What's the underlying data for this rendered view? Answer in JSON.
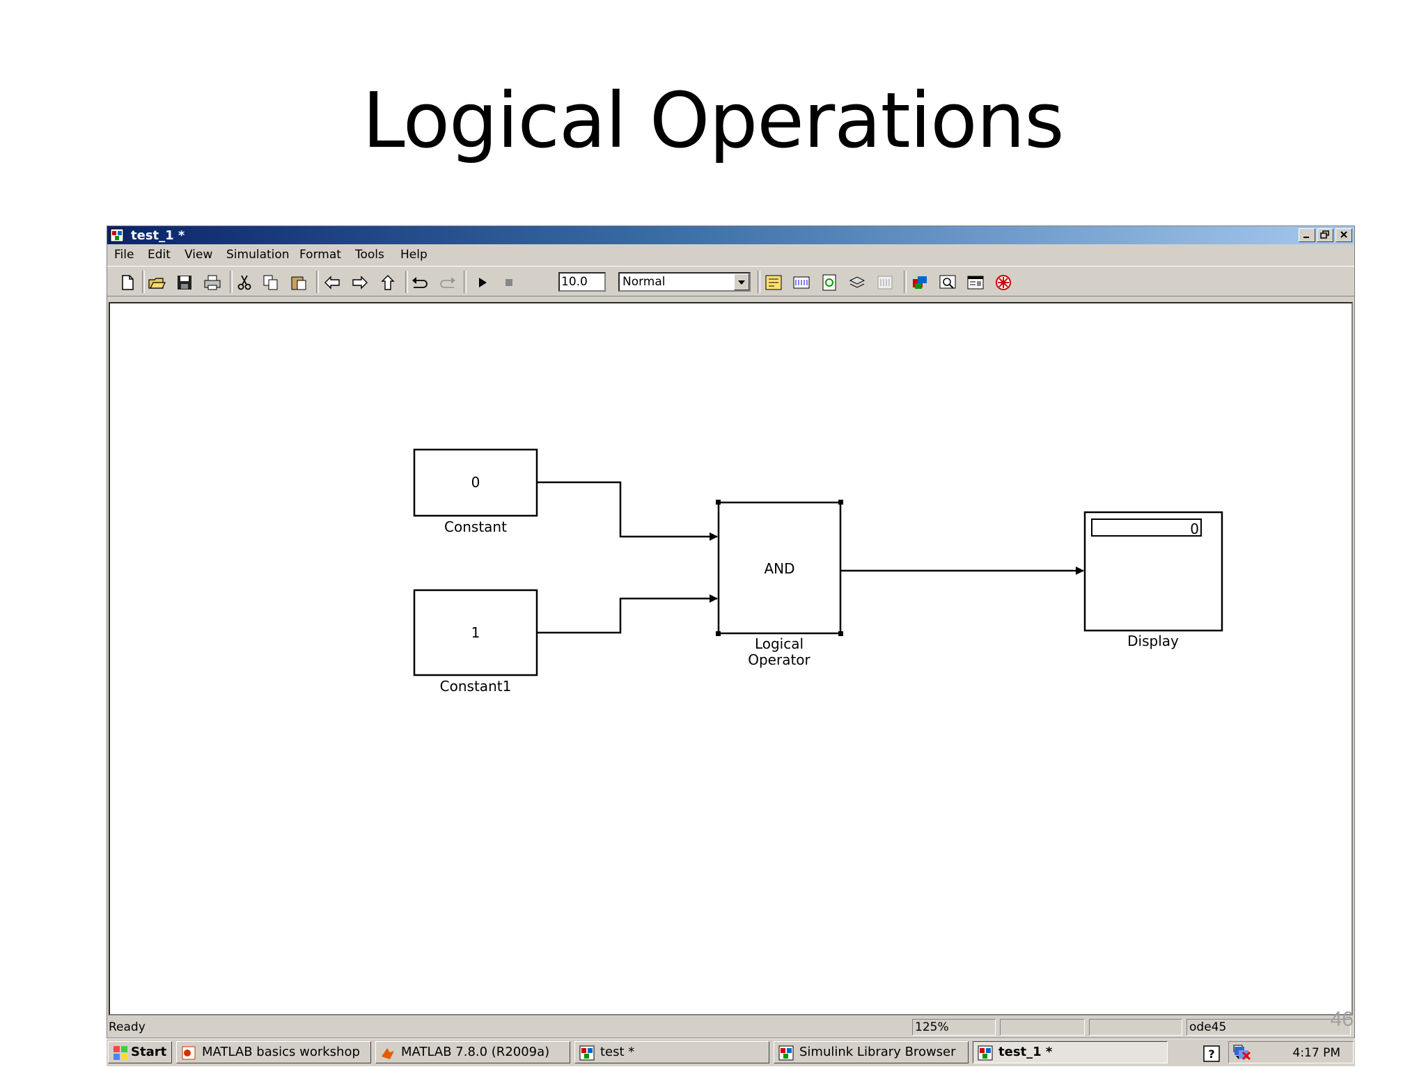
{
  "slide": {
    "title": "Logical Operations",
    "page_number": "46"
  },
  "window": {
    "title": "test_1 *",
    "menu": [
      "File",
      "Edit",
      "View",
      "Simulation",
      "Format",
      "Tools",
      "Help"
    ],
    "toolbar": {
      "stop_time": "10.0",
      "sim_mode": "Normal"
    },
    "status": {
      "state": "Ready",
      "zoom": "125%",
      "solver": "ode45"
    }
  },
  "diagram": {
    "constant": {
      "value": "0",
      "label": "Constant"
    },
    "constant1": {
      "value": "1",
      "label": "Constant1"
    },
    "logical_operator": {
      "operator": "AND",
      "label_line1": "Logical",
      "label_line2": "Operator"
    },
    "display": {
      "value": "0",
      "label": "Display"
    }
  },
  "taskbar": {
    "start": "Start",
    "tasks": [
      "MATLAB basics workshop",
      "MATLAB  7.8.0 (R2009a)",
      "test *",
      "Simulink Library Browser",
      "test_1 *"
    ],
    "clock": "4:17 PM"
  },
  "colors": {
    "titlebar_start": "#0a246a",
    "titlebar_end": "#a6caf0",
    "chrome": "#d4d0c8"
  }
}
